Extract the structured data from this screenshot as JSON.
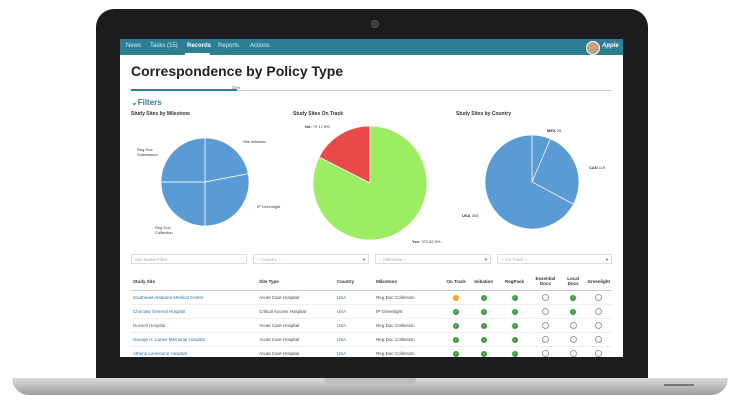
{
  "nav": {
    "items": [
      "News",
      "Tasks (15)",
      "Records",
      "Reports",
      "Actions"
    ],
    "active": "Records",
    "brand": "Apple"
  },
  "page": {
    "title": "Correspondence by Policy Type",
    "progress_label": "20%",
    "progress": 0.22,
    "filters_label": "Filters"
  },
  "charts": [
    {
      "title": "Study Sites by Milestone",
      "type": "pie",
      "slices": [
        {
          "label": "Site Initiation",
          "value": 22,
          "color": "#5b9bd5"
        },
        {
          "label": "IP Greenlight",
          "value": 28,
          "color": "#5b9bd5"
        },
        {
          "label": "Reg Doc Collection",
          "value": 25,
          "color": "#5b9bd5"
        },
        {
          "label": "Reg Doc Submission",
          "value": 25,
          "color": "#5b9bd5"
        }
      ]
    },
    {
      "title": "Study Sites On Track",
      "type": "pie",
      "slices": [
        {
          "label": "No:",
          "value_text": "79",
          "pct": "17.5%",
          "value": 79,
          "color": "#e84a4a"
        },
        {
          "label": "Yes:",
          "value_text": "372",
          "pct": "82.5%",
          "value": 372,
          "color": "#9ded64"
        }
      ]
    },
    {
      "title": "Study Sites by Country",
      "type": "pie",
      "slices": [
        {
          "label": "MEX",
          "value_text": "29",
          "value": 29,
          "color": "#5b9bd5"
        },
        {
          "label": "CAN",
          "value_text": "119",
          "value": 119,
          "color": "#5b9bd5"
        },
        {
          "label": "USA",
          "value_text": "303",
          "value": 303,
          "color": "#5b9bd5"
        }
      ]
    }
  ],
  "filters": {
    "site_name_placeholder": "Site Name Filter",
    "country": "-- Country --",
    "milestone": "-- Milestone --",
    "on_track": "-- On Track --"
  },
  "table": {
    "headers": [
      "Study Site",
      "Site Type",
      "Country",
      "Milestone",
      "On Track",
      "Initiation",
      "RegPack",
      "Essential Docs",
      "Local Docs",
      "Greenlight"
    ],
    "rows": [
      {
        "site": "Southeast Alabama Medical Center",
        "type": "Acute Care Hospital",
        "country": "USA",
        "milestone": "Reg Doc Collection",
        "status": [
          "warn",
          "ok",
          "ok",
          "pending",
          "ok",
          "pending"
        ]
      },
      {
        "site": "Choctaw General Hospital",
        "type": "Critical Access Hospital",
        "country": "USA",
        "milestone": "IP Greenlight",
        "status": [
          "ok",
          "ok",
          "ok",
          "pending",
          "ok",
          "pending"
        ]
      },
      {
        "site": "Russell Hospital",
        "type": "Acute Care Hospital",
        "country": "USA",
        "milestone": "Reg Doc Collection",
        "status": [
          "ok",
          "ok",
          "ok",
          "pending",
          "pending",
          "pending"
        ]
      },
      {
        "site": "George H. Lanier Memorial Hospital",
        "type": "Acute Care Hospital",
        "country": "USA",
        "milestone": "Reg Doc Collection",
        "status": [
          "ok",
          "ok",
          "ok",
          "pending",
          "pending",
          "pending"
        ]
      },
      {
        "site": "Athens-Limestone Hospital",
        "type": "Acute Care Hospital",
        "country": "USA",
        "milestone": "Reg Doc Collection",
        "status": [
          "ok",
          "ok",
          "ok",
          "pending",
          "pending",
          "pending"
        ]
      }
    ]
  }
}
